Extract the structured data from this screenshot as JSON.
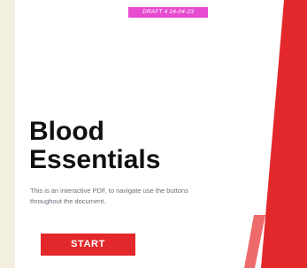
{
  "draft_badge": "DRAFT 4  24-04-23",
  "title_line1": "Blood",
  "title_line2": "Essentials",
  "subtitle": "This is an interactive PDF, to navigate use the buttons throughout the document.",
  "start_button": "START",
  "colors": {
    "background": "#f3efe0",
    "page": "#ffffff",
    "accent_red": "#e3282b",
    "light_red": "#ee6b6b",
    "badge": "#e64bd0"
  }
}
